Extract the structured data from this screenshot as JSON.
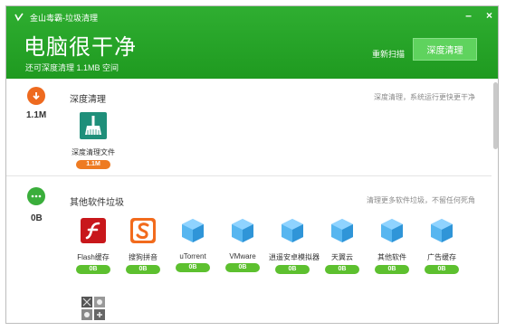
{
  "app": {
    "window_title": "金山毒霸-垃圾清理",
    "controls": {
      "minimize": "–",
      "close": "×"
    }
  },
  "header": {
    "title": "电脑很干净",
    "subtitle": "还可深度清理 1.1MB 空间",
    "rescan_label": "重新扫描",
    "deep_clean_label": "深度清理"
  },
  "sections": {
    "deep": {
      "icon": "arrow-down-icon",
      "size": "1.1M",
      "title": "深度清理",
      "hint": "深度清理，系统运行更快更干净",
      "items": [
        {
          "name": "深度清理文件",
          "size": "1.1M",
          "icon": "broom-icon"
        }
      ]
    },
    "other": {
      "icon": "ellipsis-icon",
      "size": "0B",
      "title": "其他软件垃圾",
      "hint": "清理更多软件垃圾，不留任何死角",
      "items": [
        {
          "name": "Flash缓存",
          "size": "0B",
          "icon": "flash-icon"
        },
        {
          "name": "搜狗拼音",
          "size": "0B",
          "icon": "sogou-icon"
        },
        {
          "name": "uTorrent",
          "size": "0B",
          "icon": "cube-icon"
        },
        {
          "name": "VMware",
          "size": "0B",
          "icon": "cube-icon"
        },
        {
          "name": "逍遥安卓模拟器",
          "size": "0B",
          "icon": "cube-icon"
        },
        {
          "name": "天翼云",
          "size": "0B",
          "icon": "cube-icon"
        },
        {
          "name": "其他软件",
          "size": "0B",
          "icon": "cube-icon"
        },
        {
          "name": "广告缓存",
          "size": "0B",
          "icon": "cube-icon"
        }
      ],
      "more_icon": "grid-icon"
    }
  },
  "colors": {
    "header_green": "#2fae31",
    "button_green": "#5fd35e",
    "orange": "#ee6a1f",
    "pill_green": "#5dc02f"
  }
}
